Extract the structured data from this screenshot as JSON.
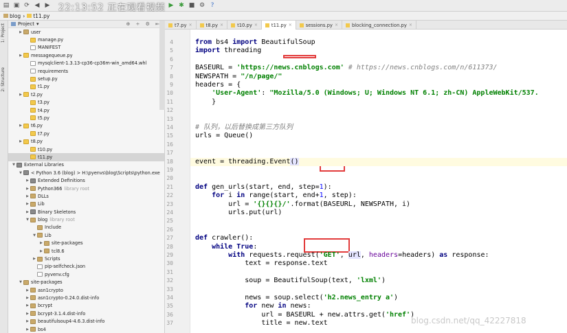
{
  "watermark": "22:13:52 正在观看视频",
  "breadcrumb": [
    "blog",
    "t11.py"
  ],
  "panel": {
    "title": "Project"
  },
  "left_tabs": [
    "1: Project",
    "2: Structure"
  ],
  "tree": [
    {
      "label": "user",
      "type": "fo",
      "indent": 1,
      "arrow": "▶"
    },
    {
      "label": "manage.py",
      "type": "py",
      "indent": 2
    },
    {
      "label": "MANIFEST",
      "type": "fi",
      "indent": 2
    },
    {
      "label": "messagequeue.py",
      "type": "py",
      "indent": 1,
      "arrow": "▶"
    },
    {
      "label": "mysqlclient-1.3.13-cp36-cp36m-win_amd64.whl",
      "type": "fi",
      "indent": 2
    },
    {
      "label": "requirements",
      "type": "fi",
      "indent": 2
    },
    {
      "label": "setup.py",
      "type": "py",
      "indent": 2
    },
    {
      "label": "t1.py",
      "type": "py",
      "indent": 2
    },
    {
      "label": "t2.py",
      "type": "py",
      "indent": 1,
      "arrow": "▶"
    },
    {
      "label": "t3.py",
      "type": "py",
      "indent": 2
    },
    {
      "label": "t4.py",
      "type": "py",
      "indent": 2
    },
    {
      "label": "t5.py",
      "type": "py",
      "indent": 2
    },
    {
      "label": "t6.py",
      "type": "py",
      "indent": 1,
      "arrow": "▶"
    },
    {
      "label": "t7.py",
      "type": "py",
      "indent": 2
    },
    {
      "label": "t8.py",
      "type": "py",
      "indent": 1,
      "arrow": "▶"
    },
    {
      "label": "t10.py",
      "type": "py",
      "indent": 2
    },
    {
      "label": "t11.py",
      "type": "py",
      "indent": 2,
      "selected": true
    },
    {
      "label": "External Libraries",
      "type": "lib",
      "indent": 0,
      "arrow": "▼"
    },
    {
      "label": "< Python 3.6 (blog) > H:\\pyenvs\\blog\\Scripts\\python.exe",
      "type": "lib",
      "indent": 1,
      "arrow": "▼"
    },
    {
      "label": "Extended Definitions",
      "type": "lib",
      "indent": 2,
      "arrow": "▶"
    },
    {
      "label": "Python366",
      "hint": "library root",
      "type": "fo",
      "indent": 2,
      "arrow": "▶"
    },
    {
      "label": "DLLs",
      "type": "fo",
      "indent": 2,
      "arrow": "▶"
    },
    {
      "label": "Lib",
      "type": "fo",
      "indent": 2,
      "arrow": "▶"
    },
    {
      "label": "Binary Skeletons",
      "type": "lib",
      "indent": 2,
      "arrow": "▶"
    },
    {
      "label": "blog",
      "hint": "library root",
      "type": "fo",
      "indent": 2,
      "arrow": "▼"
    },
    {
      "label": "Include",
      "type": "fo",
      "indent": 3
    },
    {
      "label": "Lib",
      "type": "fo",
      "indent": 3,
      "arrow": "▼"
    },
    {
      "label": "site-packages",
      "type": "fo",
      "indent": 4,
      "arrow": "▶"
    },
    {
      "label": "tcl8.6",
      "type": "fo",
      "indent": 4,
      "arrow": "▶"
    },
    {
      "label": "Scripts",
      "type": "fo",
      "indent": 3,
      "arrow": "▶"
    },
    {
      "label": "pip-selfcheck.json",
      "type": "fi",
      "indent": 3
    },
    {
      "label": "pyvenv.cfg",
      "type": "fi",
      "indent": 3
    },
    {
      "label": "site-packages",
      "type": "fo",
      "indent": 1,
      "arrow": "▼"
    },
    {
      "label": "asn1crypto",
      "type": "fo",
      "indent": 2,
      "arrow": "▶"
    },
    {
      "label": "asn1crypto-0.24.0.dist-info",
      "type": "fo",
      "indent": 2,
      "arrow": "▶"
    },
    {
      "label": "bcrypt",
      "type": "fo",
      "indent": 2,
      "arrow": "▶"
    },
    {
      "label": "bcrypt-3.1.4.dist-info",
      "type": "fo",
      "indent": 2,
      "arrow": "▶"
    },
    {
      "label": "beautifulsoup4-4.6.3.dist-info",
      "type": "fo",
      "indent": 2,
      "arrow": "▶"
    },
    {
      "label": "bs4",
      "type": "fo",
      "indent": 2,
      "arrow": "▶"
    }
  ],
  "tabs": [
    {
      "label": "t7.py",
      "active": false
    },
    {
      "label": "t8.py",
      "active": false
    },
    {
      "label": "t10.py",
      "active": false
    },
    {
      "label": "t11.py",
      "active": true
    },
    {
      "label": "sessions.py",
      "active": false
    },
    {
      "label": "blocking_connection.py",
      "active": false
    }
  ],
  "code": [
    {
      "n": 4,
      "html": "<span class='kw'>from</span> bs4 <span class='kw'>import</span> BeautifulSoup"
    },
    {
      "n": 5,
      "html": "<span class='kw'>import</span> threading"
    },
    {
      "n": 6,
      "html": ""
    },
    {
      "n": 7,
      "html": "BASEURL = <span class='str'>'https://news.cnblogs.com'</span> <span class='cm'># https://news.cnblogs.com/n/611373/</span>"
    },
    {
      "n": 8,
      "html": "NEWSPATH = <span class='str'>\"/n/page/\"</span>"
    },
    {
      "n": 9,
      "html": "headers = {"
    },
    {
      "n": 10,
      "html": "    <span class='str'>'User-Agent'</span>: <span class='str'>\"Mozilla/5.0 (Windows; U; Windows NT 6.1; zh-CN) AppleWebKit/537.</span>"
    },
    {
      "n": 11,
      "html": "    }"
    },
    {
      "n": 12,
      "html": ""
    },
    {
      "n": 13,
      "html": ""
    },
    {
      "n": 14,
      "html": "<span class='cm'># 队列，以后替换成第三方队列</span>"
    },
    {
      "n": 15,
      "html": "urls = Queue()"
    },
    {
      "n": 16,
      "html": ""
    },
    {
      "n": 17,
      "html": ""
    },
    {
      "n": 18,
      "html": "event = threading.Event<span class='hl'>()</span>",
      "cur": true
    },
    {
      "n": 19,
      "html": ""
    },
    {
      "n": 20,
      "html": ""
    },
    {
      "n": 21,
      "html": "<span class='kw'>def</span> gen_urls(start, end, step=<span class='num'>1</span>):"
    },
    {
      "n": 22,
      "html": "    <span class='kw'>for</span> i <span class='kw'>in</span> range(start, end+<span class='num'>1</span>, step):"
    },
    {
      "n": 23,
      "html": "        url = <span class='str'>'{}{}{}/'</span>.format(BASEURL, NEWSPATH, i)"
    },
    {
      "n": 24,
      "html": "        urls.put(url)"
    },
    {
      "n": 25,
      "html": ""
    },
    {
      "n": 26,
      "html": ""
    },
    {
      "n": 27,
      "html": "<span class='kw'>def</span> crawler():"
    },
    {
      "n": 28,
      "html": "    <span class='kw'>while</span> <span class='kw'>True</span>:"
    },
    {
      "n": 29,
      "html": "        <span class='kw'>with</span> requests.request(<span class='str'>'GET'</span>, <span class='hl'>url</span>, <span class='kwarg'>headers</span>=headers) <span class='kw'>as</span> response:"
    },
    {
      "n": 30,
      "html": "            text = response.text"
    },
    {
      "n": 31,
      "html": ""
    },
    {
      "n": 32,
      "html": "            soup = BeautifulSoup(text, <span class='str'>'lxml'</span>)"
    },
    {
      "n": 33,
      "html": ""
    },
    {
      "n": 34,
      "html": "            news = soup.select(<span class='str'>'h2.news_entry a'</span>)"
    },
    {
      "n": 35,
      "html": "            <span class='kw'>for</span> new <span class='kw'>in</span> news:"
    },
    {
      "n": 36,
      "html": "                url = BASEURL + new.attrs.get(<span class='str'>'href'</span>)"
    },
    {
      "n": 37,
      "html": "                title = new.text"
    }
  ],
  "footer_watermark": "blog.csdn.net/qq_42227818"
}
